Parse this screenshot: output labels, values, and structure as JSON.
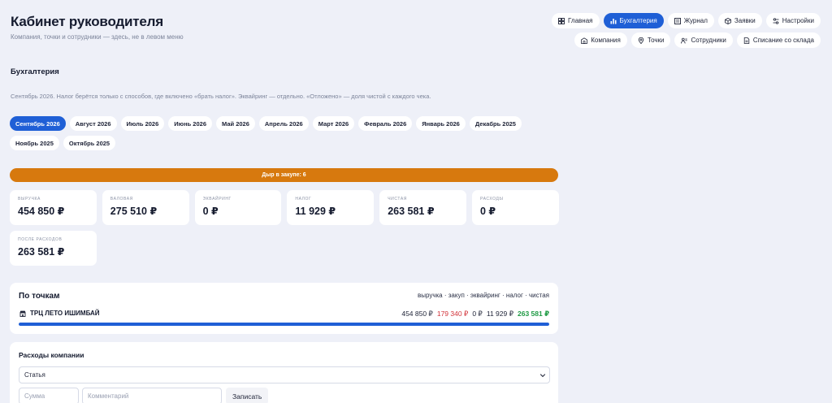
{
  "header": {
    "title": "Кабинет руководителя",
    "subtitle": "Компания, точки и сотрудники — здесь, не в левом меню"
  },
  "nav": {
    "row1": [
      {
        "label": "Главная",
        "icon": "grid-icon",
        "active": false
      },
      {
        "label": "Бухгалтерия",
        "icon": "bar-chart-icon",
        "active": true
      },
      {
        "label": "Журнал",
        "icon": "list-icon",
        "active": false
      },
      {
        "label": "Заявки",
        "icon": "box-icon",
        "active": false
      },
      {
        "label": "Настройки",
        "icon": "sliders-icon",
        "active": false
      }
    ],
    "row2": [
      {
        "label": "Компания",
        "icon": "building-icon",
        "active": false
      },
      {
        "label": "Точки",
        "icon": "map-pin-icon",
        "active": false
      },
      {
        "label": "Сотрудники",
        "icon": "users-icon",
        "active": false
      },
      {
        "label": "Списание со склада",
        "icon": "document-icon",
        "active": false
      }
    ]
  },
  "section": {
    "title": "Бухгалтерия",
    "description": "Сентябрь 2026. Налог берётся только с способов, где включено «брать налог». Эквайринг — отдельно. «Отложено» — доля чистой с каждого чека."
  },
  "months": [
    {
      "label": "Сентябрь 2026",
      "active": true
    },
    {
      "label": "Август 2026",
      "active": false
    },
    {
      "label": "Июль 2026",
      "active": false
    },
    {
      "label": "Июнь 2026",
      "active": false
    },
    {
      "label": "Май 2026",
      "active": false
    },
    {
      "label": "Апрель 2026",
      "active": false
    },
    {
      "label": "Март 2026",
      "active": false
    },
    {
      "label": "Февраль 2026",
      "active": false
    },
    {
      "label": "Январь 2026",
      "active": false
    },
    {
      "label": "Декабрь 2025",
      "active": false
    },
    {
      "label": "Ноябрь 2025",
      "active": false
    },
    {
      "label": "Октябрь 2025",
      "active": false
    }
  ],
  "alert": {
    "text": "Дыр в закупе: 6",
    "color": "#d7790e"
  },
  "stats": [
    {
      "label": "ВЫРУЧКА",
      "value": "454 850 ₽"
    },
    {
      "label": "ВАЛОВАЯ",
      "value": "275 510 ₽"
    },
    {
      "label": "ЭКВАЙРИНГ",
      "value": "0 ₽"
    },
    {
      "label": "НАЛОГ",
      "value": "11 929 ₽"
    },
    {
      "label": "ЧИСТАЯ",
      "value": "263 581 ₽"
    },
    {
      "label": "РАСХОДЫ",
      "value": "0 ₽"
    },
    {
      "label": "ПОСЛЕ РАСХОДОВ",
      "value": "263 581 ₽"
    }
  ],
  "points": {
    "title": "По точкам",
    "legend": "выручка · закуп · эквайринг · налог · чистая",
    "rows": [
      {
        "name": "ТРЦ ЛЕТО ИШИМБАЙ",
        "revenue": "454 850 ₽",
        "purchase": "179 340 ₽",
        "acquiring": "0 ₽",
        "tax": "11 929 ₽",
        "net": "263 581 ₽",
        "progress": 1.0
      }
    ]
  },
  "expenses": {
    "title": "Расходы компании",
    "select_value": "Статья",
    "sum_placeholder": "Сумма",
    "comment_placeholder": "Комментарий",
    "submit_label": "Записать"
  },
  "colors": {
    "accent": "#1f5fd6",
    "warning": "#d7790e",
    "negative": "#d2343a",
    "positive": "#1f9a44"
  }
}
